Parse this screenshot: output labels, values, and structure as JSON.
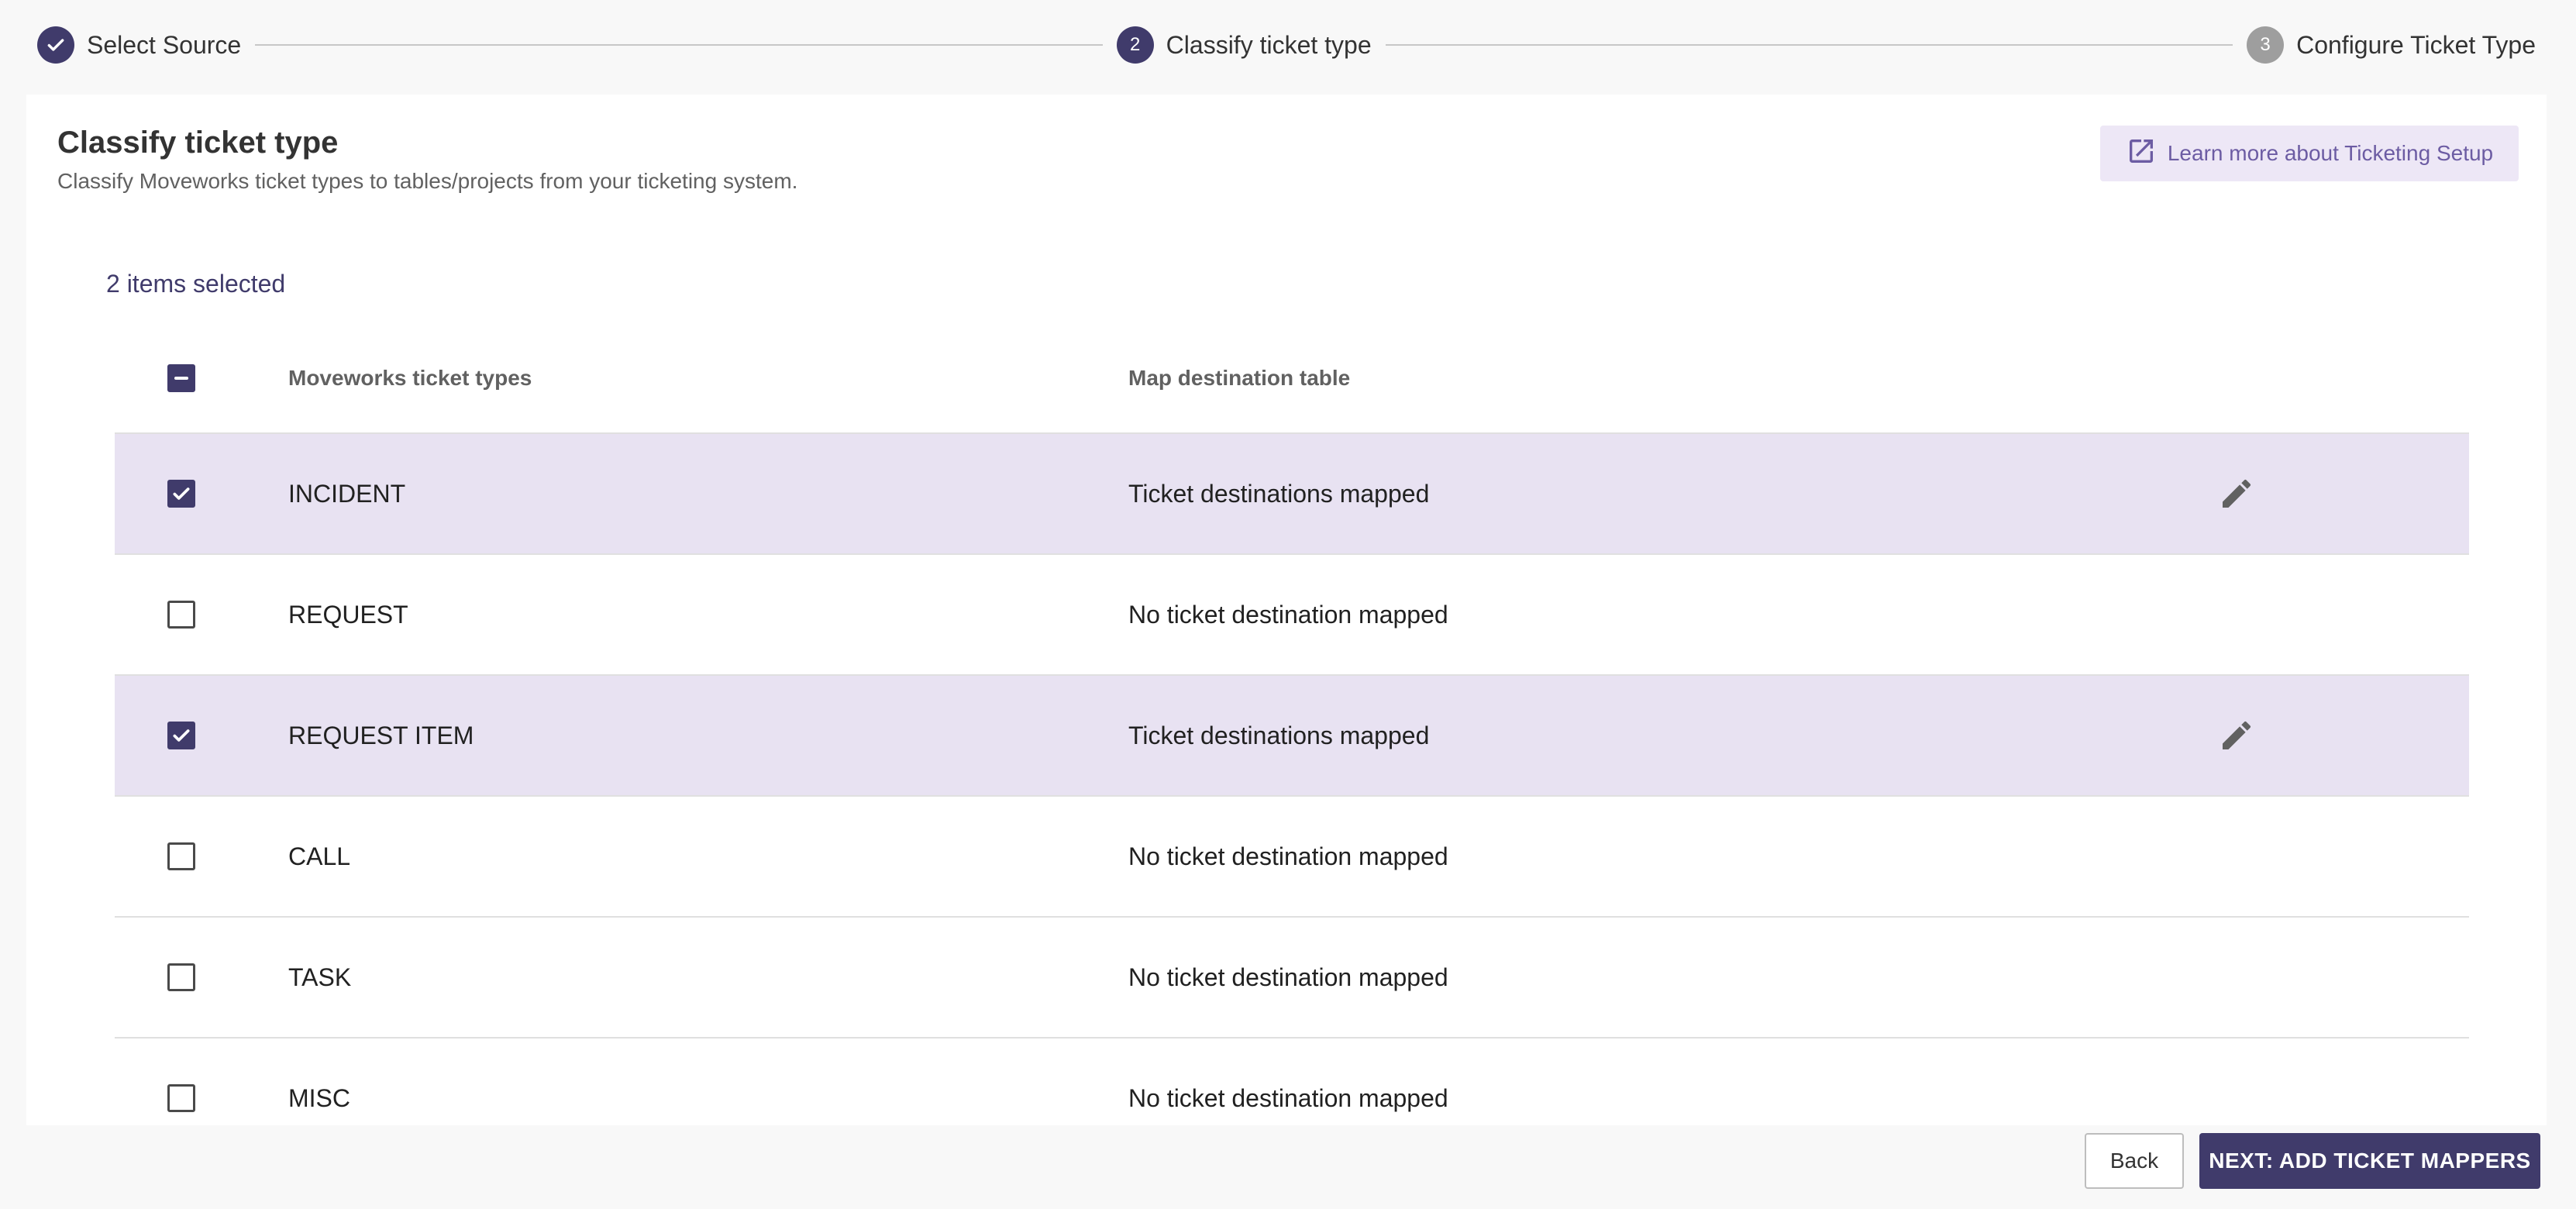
{
  "stepper": {
    "steps": [
      {
        "number": "1",
        "label": "Select Source",
        "state": "done"
      },
      {
        "number": "2",
        "label": "Classify ticket type",
        "state": "active"
      },
      {
        "number": "3",
        "label": "Configure Ticket Type",
        "state": "todo"
      }
    ]
  },
  "header": {
    "title": "Classify ticket type",
    "subtitle": "Classify Moveworks ticket types to tables/projects from your ticketing system.",
    "learn_more": "Learn more about Ticketing Setup"
  },
  "selection": {
    "count_text": "2 items selected"
  },
  "table": {
    "columns": [
      "Moveworks ticket types",
      "Map destination table"
    ],
    "rows": [
      {
        "type": "INCIDENT",
        "destination": "Ticket destinations mapped",
        "checked": true
      },
      {
        "type": "REQUEST",
        "destination": "No ticket destination mapped",
        "checked": false
      },
      {
        "type": "REQUEST ITEM",
        "destination": "Ticket destinations mapped",
        "checked": true
      },
      {
        "type": "CALL",
        "destination": "No ticket destination mapped",
        "checked": false
      },
      {
        "type": "TASK",
        "destination": "No ticket destination mapped",
        "checked": false
      },
      {
        "type": "MISC",
        "destination": "No ticket destination mapped",
        "checked": false
      }
    ]
  },
  "footer": {
    "back_label": "Back",
    "next_label": "NEXT: ADD TICKET MAPPERS"
  },
  "colors": {
    "primary": "#403b6b",
    "selected_row": "#e8e2f2",
    "link": "#6c5ca3",
    "link_bg": "#ede7f6"
  }
}
